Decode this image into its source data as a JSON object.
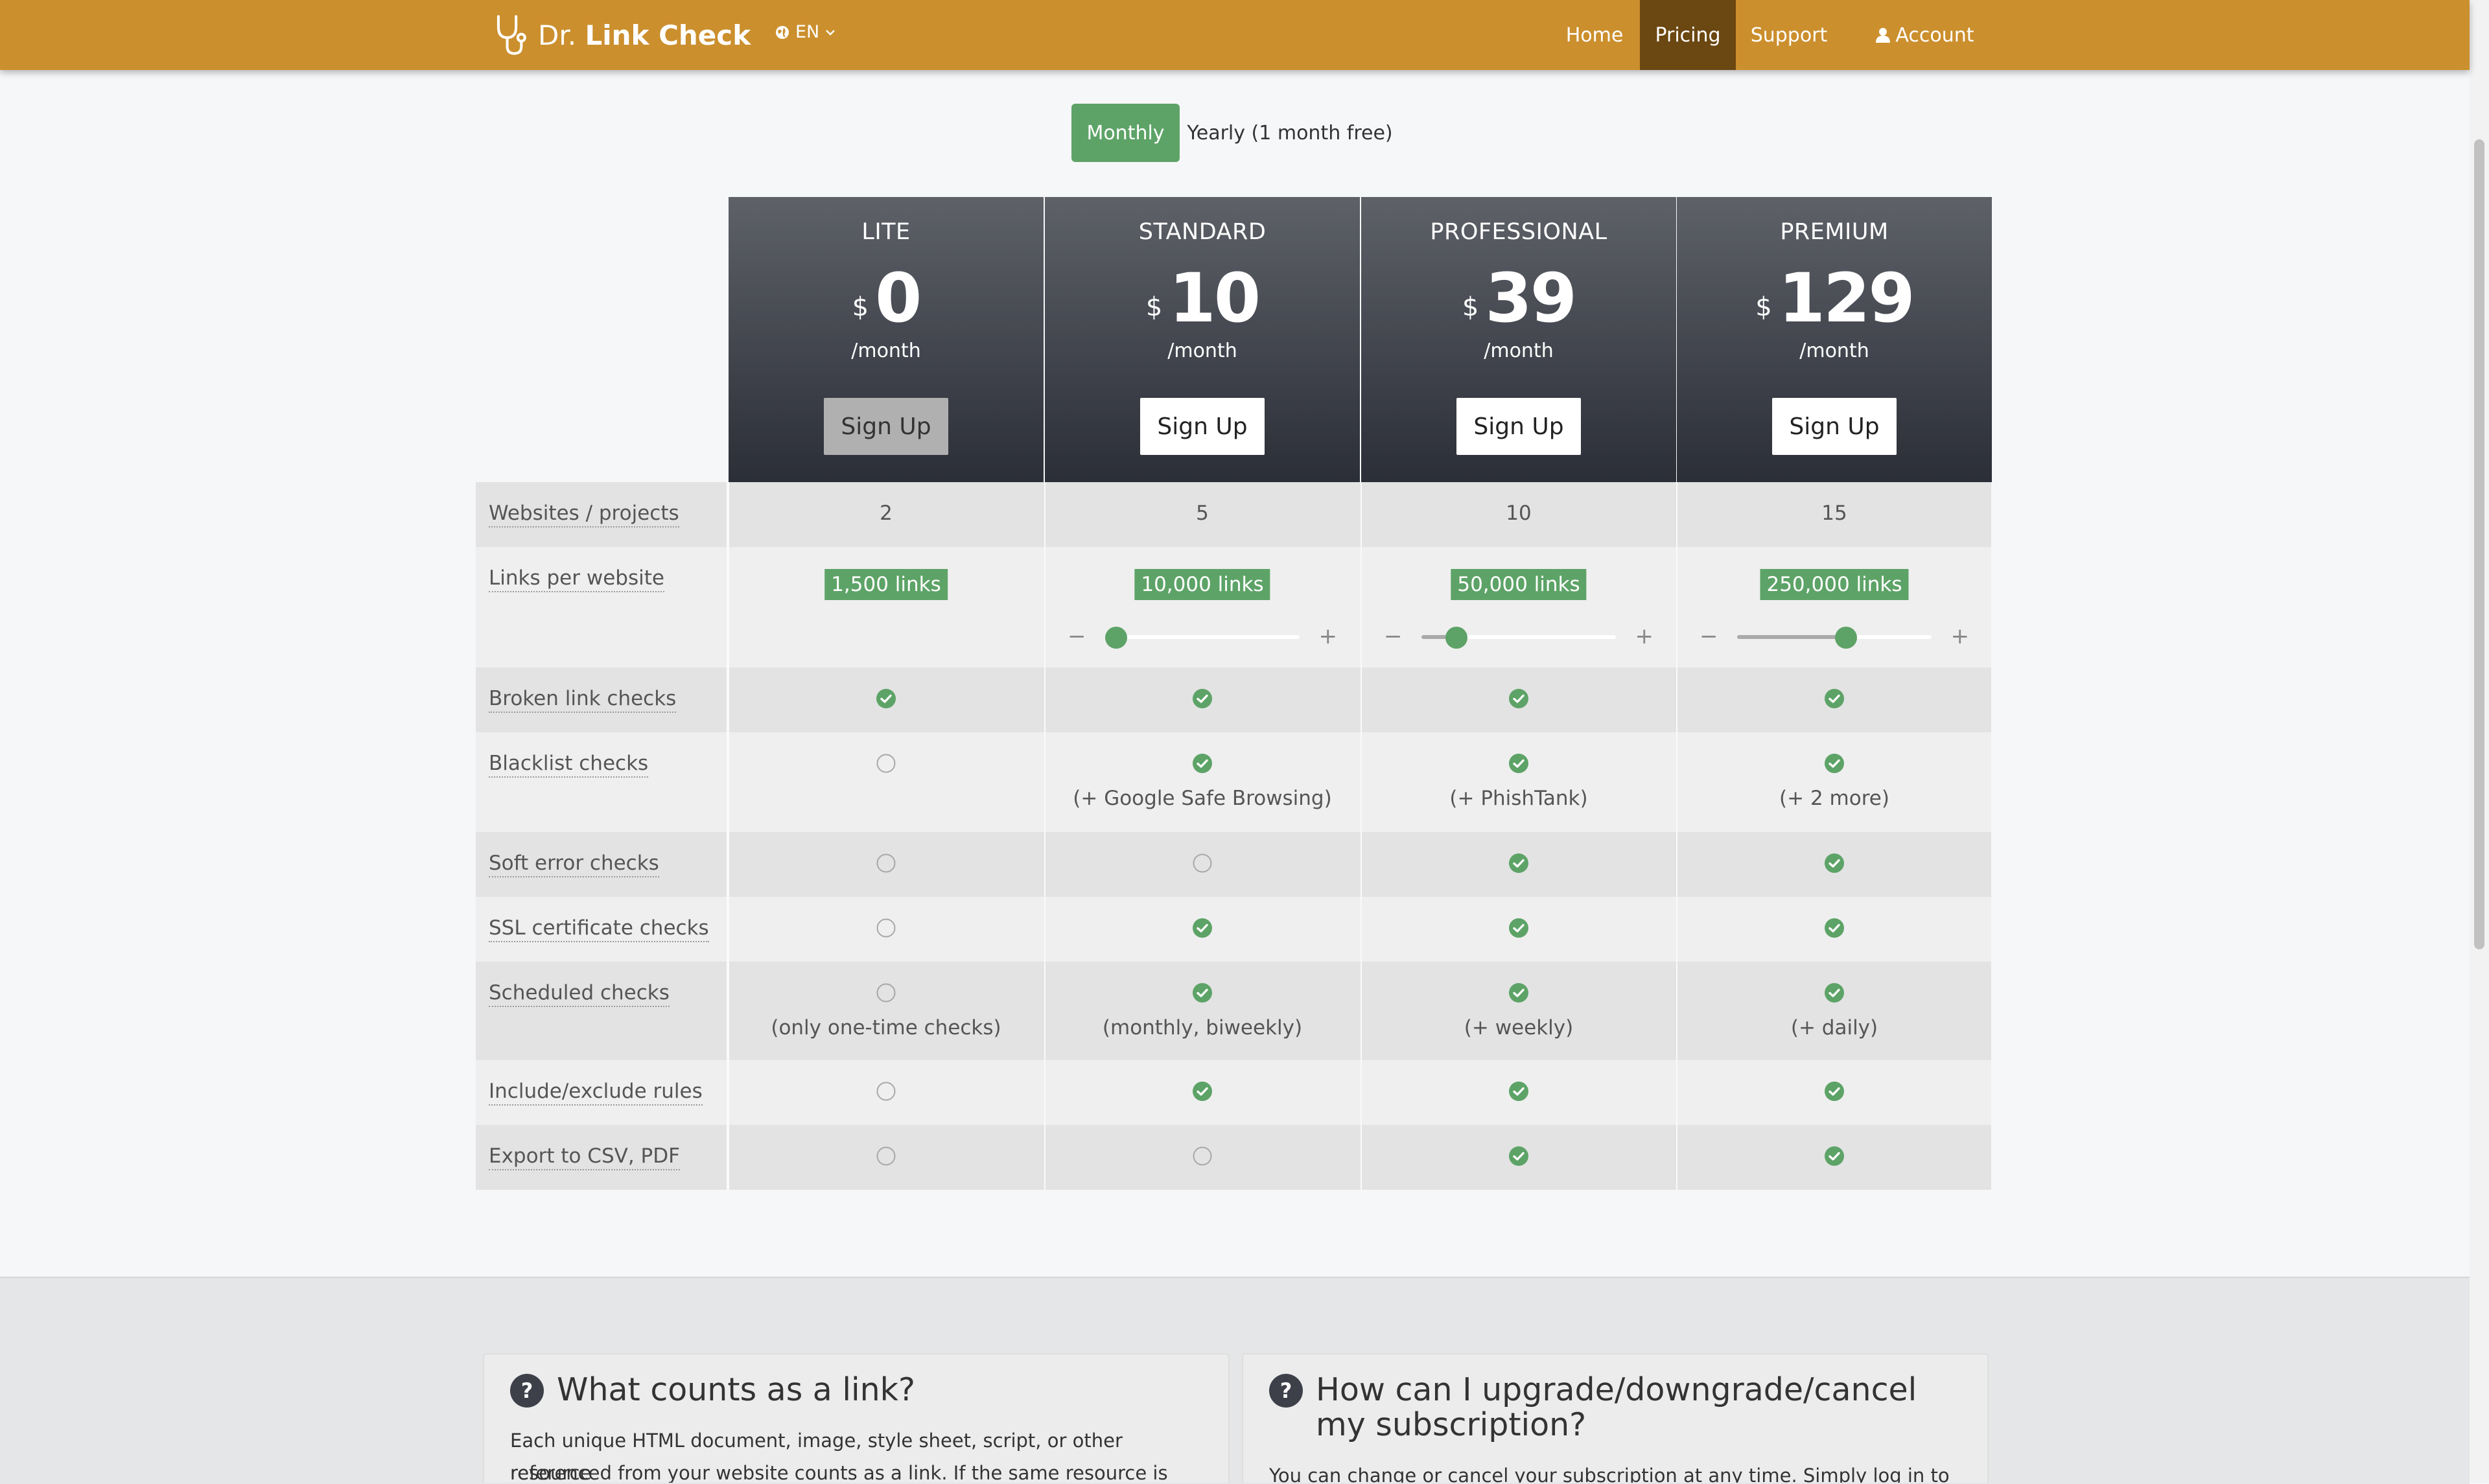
{
  "nav": {
    "brand_prefix": "Dr.",
    "brand_name": "Link Check",
    "language": "EN",
    "items": [
      {
        "label": "Home"
      },
      {
        "label": "Pricing",
        "active": true
      },
      {
        "label": "Support"
      },
      {
        "label": "Account"
      }
    ]
  },
  "billing": {
    "monthly_label": "Monthly",
    "yearly_label": "Yearly (1 month free)",
    "selected": "Monthly"
  },
  "plans": [
    {
      "name": "LITE",
      "currency": "$",
      "price": "0",
      "period": "/month",
      "signup": "Sign Up",
      "signup_disabled": true
    },
    {
      "name": "STANDARD",
      "currency": "$",
      "price": "10",
      "period": "/month",
      "signup": "Sign Up"
    },
    {
      "name": "PROFESSIONAL",
      "currency": "$",
      "price": "39",
      "period": "/month",
      "signup": "Sign Up"
    },
    {
      "name": "PREMIUM",
      "currency": "$",
      "price": "129",
      "period": "/month",
      "signup": "Sign Up"
    }
  ],
  "features": {
    "websites": {
      "label": "Websites / projects",
      "values": [
        "2",
        "5",
        "10",
        "15"
      ]
    },
    "links": {
      "label": "Links per website",
      "values": [
        "1,500 links",
        "10,000 links",
        "50,000 links",
        "250,000 links"
      ],
      "slider_minus": "−",
      "slider_plus": "+",
      "slider_levels": [
        null,
        0.0,
        0.18,
        0.56
      ]
    },
    "broken": {
      "label": "Broken link checks",
      "values": [
        true,
        true,
        true,
        true
      ]
    },
    "blacklist": {
      "label": "Blacklist checks",
      "values": [
        false,
        true,
        true,
        true
      ],
      "notes": [
        "",
        "(+ Google Safe Browsing)",
        "(+ PhishTank)",
        "(+ 2 more)"
      ]
    },
    "soft_error": {
      "label": "Soft error checks",
      "values": [
        false,
        false,
        true,
        true
      ]
    },
    "ssl": {
      "label": "SSL certificate checks",
      "values": [
        false,
        true,
        true,
        true
      ]
    },
    "scheduled": {
      "label": "Scheduled checks",
      "values": [
        false,
        true,
        true,
        true
      ],
      "notes": [
        "(only one-time checks)",
        "(monthly, biweekly)",
        "(+ weekly)",
        "(+ daily)"
      ]
    },
    "rules": {
      "label": "Include/exclude rules",
      "values": [
        false,
        true,
        true,
        true
      ]
    },
    "export": {
      "label": "Export to CSV, PDF",
      "values": [
        false,
        false,
        true,
        true
      ]
    }
  },
  "faq": [
    {
      "question": "What counts as a link?",
      "answer_lines": [
        "Each unique HTML document, image, style sheet, script, or other resource",
        "referenced from your website counts as a link. If the same resource is linked from"
      ]
    },
    {
      "question": "How can I upgrade/downgrade/cancel my subscription?",
      "answer_lines": [
        "You can change or cancel your subscription at any time. Simply log in to your"
      ]
    }
  ],
  "colors": {
    "nav_bg": "#cb8f2d",
    "nav_active": "#6b4711",
    "accent_green": "#5da367",
    "header_top": "#5e6168",
    "header_bottom": "#2b2e37"
  },
  "icons": {
    "logo": "stethoscope-icon",
    "language": "globe-icon",
    "account": "user-icon",
    "included": "check-circle-icon",
    "not_included": "empty-circle-icon",
    "faq": "question-circle-icon"
  }
}
